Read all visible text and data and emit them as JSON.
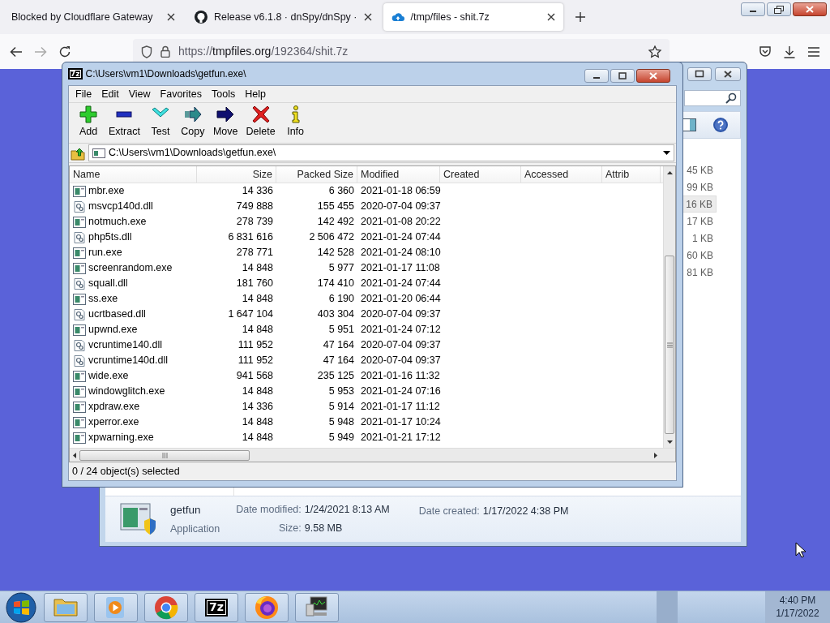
{
  "browser": {
    "tabs": [
      {
        "title": "Blocked by Cloudflare Gateway",
        "kind": "none",
        "selected": false
      },
      {
        "title": "Release v6.1.8 · dnSpy/dnSpy ·",
        "kind": "github",
        "selected": false
      },
      {
        "title": "/tmp/files - shit.7z",
        "kind": "cloud",
        "selected": true
      }
    ],
    "url": {
      "scheme": "https://",
      "host": "tmpfiles.org",
      "path": "/192364/shit.7z"
    }
  },
  "explorer": {
    "size_rows": [
      {
        "text": "45 KB",
        "hovered": false
      },
      {
        "text": "99 KB",
        "hovered": false
      },
      {
        "text": "16 KB",
        "hovered": true
      },
      {
        "text": "17 KB",
        "hovered": false
      },
      {
        "text": "1 KB",
        "hovered": false
      },
      {
        "text": "60 KB",
        "hovered": false
      },
      {
        "text": "81 KB",
        "hovered": false
      }
    ],
    "details": {
      "name": "getfun",
      "type": "Application",
      "fields": [
        {
          "label": "Date modified:",
          "value": "1/24/2021 8:13 AM"
        },
        {
          "label": "Size:",
          "value": "9.58 MB"
        },
        {
          "label": "Date created:",
          "value": "1/17/2022 4:38 PM"
        }
      ]
    }
  },
  "sevenzip": {
    "icon_text": "7z",
    "title": "C:\\Users\\vm1\\Downloads\\getfun.exe\\",
    "menu": [
      "File",
      "Edit",
      "View",
      "Favorites",
      "Tools",
      "Help"
    ],
    "toolbar": [
      {
        "label": "Add",
        "kind": "add"
      },
      {
        "label": "Extract",
        "kind": "extract"
      },
      {
        "label": "Test",
        "kind": "test"
      },
      {
        "label": "Copy",
        "kind": "copy"
      },
      {
        "label": "Move",
        "kind": "move"
      },
      {
        "label": "Delete",
        "kind": "delete"
      },
      {
        "label": "Info",
        "kind": "info"
      }
    ],
    "path": "C:\\Users\\vm1\\Downloads\\getfun.exe\\",
    "columns": [
      "Name",
      "Size",
      "Packed Size",
      "Modified",
      "Created",
      "Accessed",
      "Attrib"
    ],
    "rows": [
      {
        "name": "mbr.exe",
        "kind": "exe",
        "size": "14 336",
        "packed": "6 360",
        "modified": "2021-01-18 06:59"
      },
      {
        "name": "msvcp140d.dll",
        "kind": "dll",
        "size": "749 888",
        "packed": "155 455",
        "modified": "2020-07-04 09:37"
      },
      {
        "name": "notmuch.exe",
        "kind": "exe",
        "size": "278 739",
        "packed": "142 492",
        "modified": "2021-01-08 20:22"
      },
      {
        "name": "php5ts.dll",
        "kind": "dll",
        "size": "6 831 616",
        "packed": "2 506 472",
        "modified": "2021-01-24 07:44"
      },
      {
        "name": "run.exe",
        "kind": "exe",
        "size": "278 771",
        "packed": "142 528",
        "modified": "2021-01-24 08:10"
      },
      {
        "name": "screenrandom.exe",
        "kind": "exe",
        "size": "14 848",
        "packed": "5 977",
        "modified": "2021-01-17 11:08"
      },
      {
        "name": "squall.dll",
        "kind": "dll",
        "size": "181 760",
        "packed": "174 410",
        "modified": "2021-01-24 07:44"
      },
      {
        "name": "ss.exe",
        "kind": "exe",
        "size": "14 848",
        "packed": "6 190",
        "modified": "2021-01-20 06:44"
      },
      {
        "name": "ucrtbased.dll",
        "kind": "dll",
        "size": "1 647 104",
        "packed": "403 304",
        "modified": "2020-07-04 09:37"
      },
      {
        "name": "upwnd.exe",
        "kind": "exe",
        "size": "14 848",
        "packed": "5 951",
        "modified": "2021-01-24 07:12"
      },
      {
        "name": "vcruntime140.dll",
        "kind": "dll",
        "size": "111 952",
        "packed": "47 164",
        "modified": "2020-07-04 09:37"
      },
      {
        "name": "vcruntime140d.dll",
        "kind": "dll",
        "size": "111 952",
        "packed": "47 164",
        "modified": "2020-07-04 09:37"
      },
      {
        "name": "wide.exe",
        "kind": "exe",
        "size": "941 568",
        "packed": "235 125",
        "modified": "2021-01-16 11:32"
      },
      {
        "name": "windowglitch.exe",
        "kind": "exe",
        "size": "14 848",
        "packed": "5 953",
        "modified": "2021-01-24 07:16"
      },
      {
        "name": "xpdraw.exe",
        "kind": "exe",
        "size": "14 336",
        "packed": "5 914",
        "modified": "2021-01-17 11:12"
      },
      {
        "name": "xperror.exe",
        "kind": "exe",
        "size": "14 848",
        "packed": "5 948",
        "modified": "2021-01-17 10:24"
      },
      {
        "name": "xpwarning.exe",
        "kind": "exe",
        "size": "14 848",
        "packed": "5 949",
        "modified": "2021-01-21 17:12"
      }
    ],
    "status": "0 / 24 object(s) selected"
  },
  "taskbar": {
    "items": [
      {
        "kind": "explorer"
      },
      {
        "kind": "media"
      },
      {
        "kind": "chrome"
      },
      {
        "kind": "sevenzip",
        "text": "7z"
      },
      {
        "kind": "firefox"
      },
      {
        "kind": "monitor"
      }
    ],
    "time": "4:40 PM",
    "date": "1/17/2022"
  }
}
